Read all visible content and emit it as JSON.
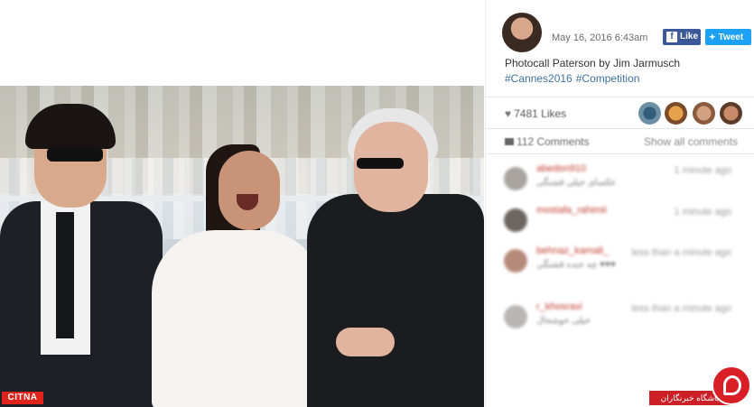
{
  "post": {
    "date": "May 16, 2016 6:43am",
    "caption": "Photocall Paterson by Jim Jarmusch",
    "hashtags": [
      "#Cannes2016",
      "#Competition"
    ]
  },
  "share": {
    "like_label": "Like",
    "tweet_label": "Tweet"
  },
  "stats": {
    "likes": "7481 Likes",
    "comments": "112 Comments",
    "show_all": "Show all comments"
  },
  "comments": [
    {
      "user": "abedon910",
      "text": "عکسای خیلی قشنگی",
      "time": "1 minute ago"
    },
    {
      "user": "mostafa_rahimii",
      "text": "",
      "time": "1 minute ago"
    },
    {
      "user": "behnaz_kamali_",
      "text": "چه خنده قشنگی ♥♥♥",
      "time": "less than a minute ago"
    },
    {
      "user": "r_khosravi",
      "text": "خیلی خوشحال",
      "time": "less than a minute ago"
    }
  ],
  "logos": {
    "citna": "CITNA",
    "club": "باشگاه خبرنگاران"
  },
  "colors": {
    "facebook": "#3b5998",
    "twitter": "#1da1f2",
    "hashtag": "#3f729b",
    "brand_red": "#d91f26"
  },
  "icons": {
    "heart": "♥",
    "comment": "▬",
    "twitter_bird": "🐦"
  }
}
